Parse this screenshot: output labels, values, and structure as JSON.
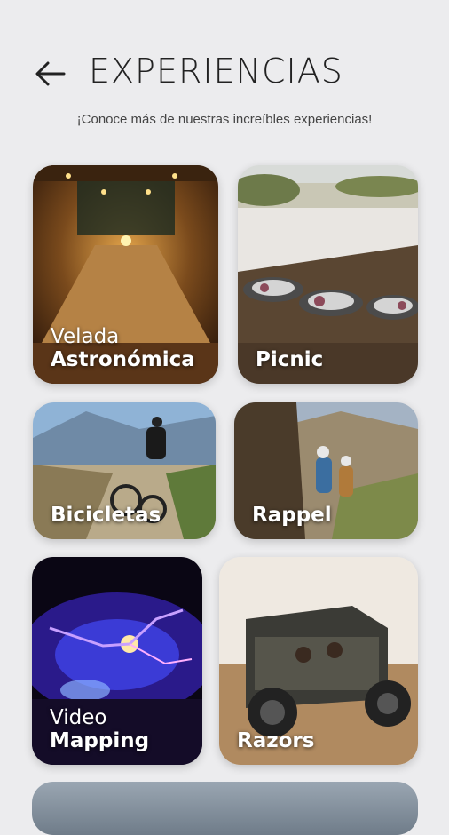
{
  "header": {
    "back_icon": "arrow-left-icon",
    "title": "EXPERIENCIAS",
    "subtitle": "¡Conoce más de nuestras increíbles experiencias!"
  },
  "experiences": [
    {
      "line1": "Velada",
      "line2": "Astronómica"
    },
    {
      "label": "Picnic"
    },
    {
      "label": "Bicicletas"
    },
    {
      "label": "Rappel"
    },
    {
      "line1": "Video",
      "line2": "Mapping"
    },
    {
      "label": "Razors"
    }
  ],
  "colors": {
    "background": "#ececee",
    "title": "#222222",
    "label_text": "#ffffff"
  }
}
